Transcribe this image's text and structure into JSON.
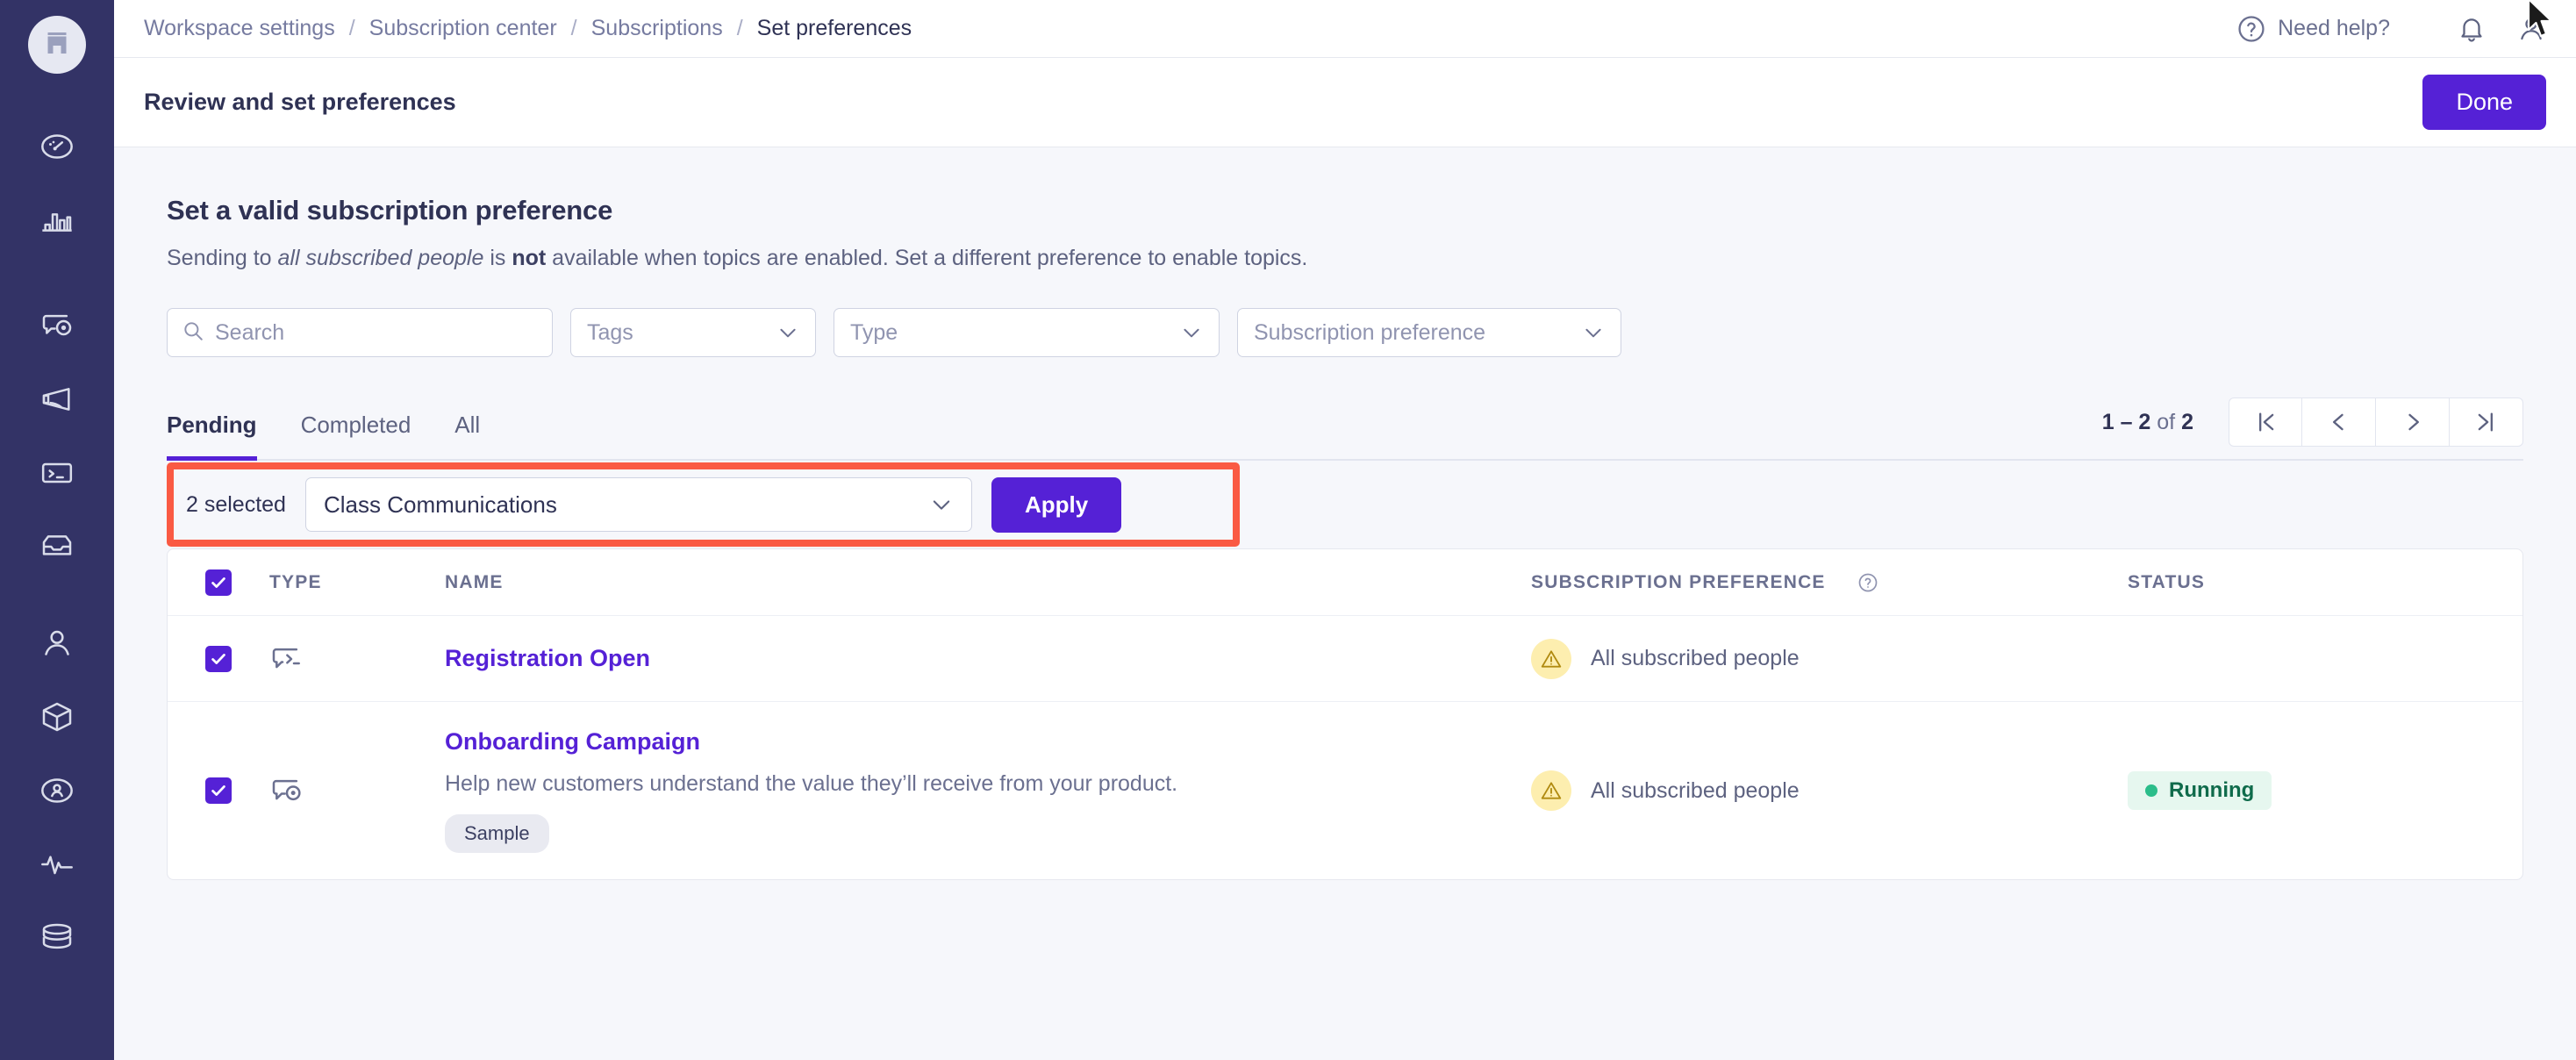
{
  "brand": {
    "accent": "#5521d6",
    "rail_bg": "#333366",
    "annotation": "#fa5a43",
    "warning": "#fdeeaf",
    "status_green": "#2bbd8a"
  },
  "rail": {
    "logo_icon": "building-icon",
    "items": [
      {
        "icon": "gauge-icon",
        "name": "sidebar-item-dashboard"
      },
      {
        "icon": "bar-chart-icon",
        "name": "sidebar-item-analytics"
      },
      {
        "icon": "chat-target-icon",
        "name": "sidebar-item-campaigns"
      },
      {
        "icon": "megaphone-icon",
        "name": "sidebar-item-broadcasts"
      },
      {
        "icon": "terminal-icon",
        "name": "sidebar-item-messages"
      },
      {
        "icon": "inbox-icon",
        "name": "sidebar-item-inbox"
      },
      {
        "icon": "user-icon",
        "name": "sidebar-item-people"
      },
      {
        "icon": "cube-icon",
        "name": "sidebar-item-products"
      },
      {
        "icon": "user-circle-icon",
        "name": "sidebar-item-accounts"
      },
      {
        "icon": "activity-icon",
        "name": "sidebar-item-activity"
      },
      {
        "icon": "database-icon",
        "name": "sidebar-item-data"
      }
    ]
  },
  "breadcrumb": {
    "items": [
      "Workspace settings",
      "Subscription center",
      "Subscriptions",
      "Set preferences"
    ],
    "separator": "/"
  },
  "topbar": {
    "help_label": "Need help?",
    "help_icon": "question-circle-icon",
    "bell_icon": "bell-icon",
    "account_icon": "user-icon"
  },
  "titlebar": {
    "title": "Review and set preferences",
    "done_label": "Done"
  },
  "section": {
    "heading": "Set a valid subscription preference",
    "desc_part1": "Sending to ",
    "desc_em": "all subscribed people",
    "desc_part2": " is ",
    "desc_strong": "not",
    "desc_part3": " available when topics are enabled. Set a different preference to enable topics."
  },
  "filters": {
    "search_placeholder": "Search",
    "search_value": "",
    "search_icon": "search-icon",
    "tags_label": "Tags",
    "type_label": "Type",
    "preference_label": "Subscription preference",
    "chevron_icon": "chevron-down-icon"
  },
  "tabs": [
    {
      "label": "Pending",
      "active": true
    },
    {
      "label": "Completed",
      "active": false
    },
    {
      "label": "All",
      "active": false
    }
  ],
  "pagination": {
    "range": "1 – 2",
    "of_word": "of",
    "total": "2",
    "first_icon": "first-page-icon",
    "prev_icon": "chevron-left-icon",
    "next_icon": "chevron-right-icon",
    "last_icon": "last-page-icon"
  },
  "bulk": {
    "selected_label": "2 selected",
    "preference_value": "Class Communications",
    "apply_label": "Apply",
    "chevron_icon": "chevron-down-icon"
  },
  "table": {
    "headers": {
      "type": "TYPE",
      "name": "NAME",
      "preference": "SUBSCRIPTION PREFERENCE",
      "preference_help_icon": "question-circle-icon",
      "status": "STATUS"
    },
    "header_checkbox_checked": true,
    "rows": [
      {
        "checked": true,
        "type_icon": "chat-terminal-icon",
        "name": "Registration Open",
        "description": "",
        "tag": "",
        "preference_icon": "warning-triangle-icon",
        "preference": "All subscribed people",
        "status": ""
      },
      {
        "checked": true,
        "type_icon": "chat-target-icon",
        "name": "Onboarding Campaign",
        "description": "Help new customers understand the value they’ll receive from your product.",
        "tag": "Sample",
        "preference_icon": "warning-triangle-icon",
        "preference": "All subscribed people",
        "status": "Running"
      }
    ]
  }
}
